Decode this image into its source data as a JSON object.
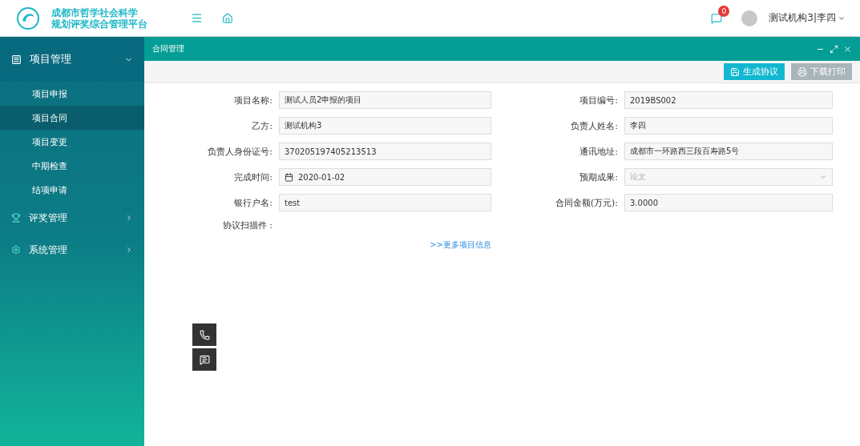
{
  "header": {
    "logo_title_lines": [
      "成都市哲学社会科学",
      "规划评奖综合管理平台"
    ],
    "message_count": "0",
    "user": "测试机构3|李四"
  },
  "sidebar": {
    "section": {
      "label": "项目管理",
      "expanded": true
    },
    "items": [
      {
        "label": "项目申报",
        "selected": false
      },
      {
        "label": "项目合同",
        "selected": true
      },
      {
        "label": "项目变更",
        "selected": false
      },
      {
        "label": "中期检查",
        "selected": false
      },
      {
        "label": "结项申请",
        "selected": false
      }
    ],
    "groups": [
      {
        "label": "评奖管理",
        "kind": "trophy"
      },
      {
        "label": "系统管理",
        "kind": "gear"
      }
    ]
  },
  "panel": {
    "title": "合同管理",
    "buttons": [
      {
        "label": "生成协议",
        "kind": "save",
        "disabled": false
      },
      {
        "label": "下载打印",
        "kind": "print",
        "disabled": true
      }
    ],
    "fields": [
      {
        "label": "项目名称:",
        "value": "测试人员2申报的项目",
        "kind": "text"
      },
      {
        "label": "项目编号:",
        "value": "2019BS002",
        "kind": "text"
      },
      {
        "label": "乙方:",
        "value": "测试机构3",
        "kind": "text"
      },
      {
        "label": "负责人姓名:",
        "value": "李四",
        "kind": "text"
      },
      {
        "label": "负责人身份证号:",
        "value": "370205197405213513",
        "kind": "text"
      },
      {
        "label": "通讯地址:",
        "value": "成都市一环路西三段百寿路5号",
        "kind": "text"
      },
      {
        "label": "完成时间:",
        "value": "2020-01-02",
        "kind": "date"
      },
      {
        "label": "预期成果:",
        "placeholder": "论文",
        "kind": "select"
      },
      {
        "label": "银行户名:",
        "value": "test",
        "kind": "text"
      },
      {
        "label": "合同金额(万元):",
        "value": "3.0000",
        "kind": "text"
      },
      {
        "label": "协议扫描件 :",
        "kind": "file"
      }
    ],
    "more_link": ">>更多项目信息"
  }
}
